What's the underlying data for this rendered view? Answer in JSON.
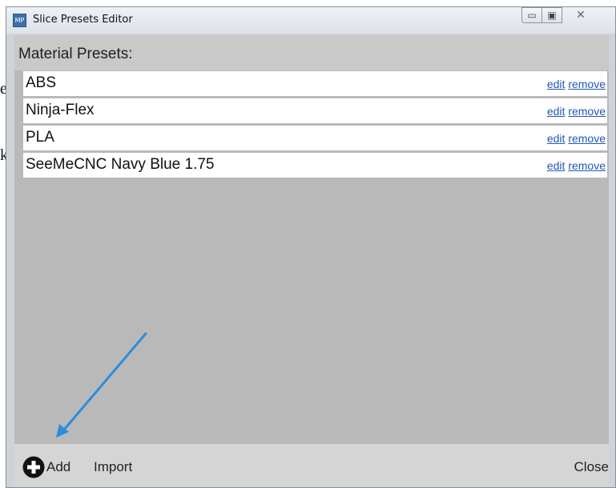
{
  "window": {
    "title": "Slice Presets Editor",
    "icon_text": "MP",
    "controls": {
      "minimize": "▭",
      "maximize": "▣",
      "close": "✕"
    }
  },
  "background": {
    "letters": [
      "e",
      "k"
    ]
  },
  "section": {
    "title": "Material Presets:"
  },
  "presets": [
    {
      "name": "ABS",
      "edit_label": "edit",
      "remove_label": "remove"
    },
    {
      "name": "Ninja-Flex",
      "edit_label": "edit",
      "remove_label": "remove"
    },
    {
      "name": "PLA",
      "edit_label": "edit",
      "remove_label": "remove"
    },
    {
      "name": "SeeMeCNC Navy Blue 1.75",
      "edit_label": "edit",
      "remove_label": "remove"
    }
  ],
  "footer": {
    "add_label": "Add",
    "import_label": "Import",
    "close_label": "Close",
    "add_icon": "plus-circle-icon"
  },
  "annotation": {
    "color": "#2b8de0",
    "icon": "arrow-icon"
  },
  "colors": {
    "link": "#1f57b8",
    "client_bg": "#b9b9b9",
    "header_bg": "#c9c9c9",
    "footer_bg": "#d5d5d5",
    "row_bg": "#ffffff"
  }
}
